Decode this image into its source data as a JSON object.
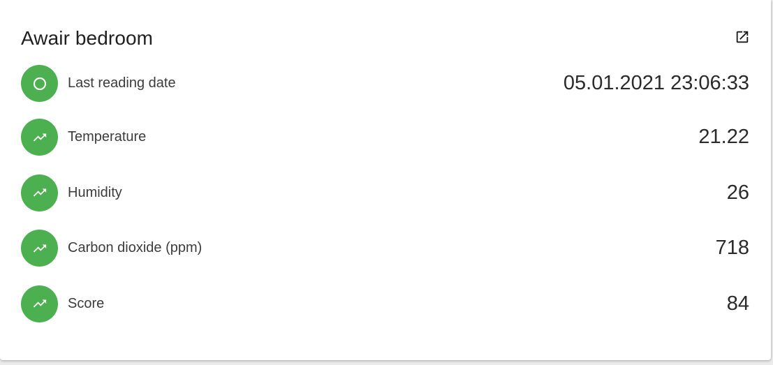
{
  "card": {
    "title": "Awair bedroom",
    "open_icon": "open-in-new-icon"
  },
  "colors": {
    "badge": "#4caf50",
    "card_background": "#ffffff",
    "page_background": "#ececec"
  },
  "rows": [
    {
      "label": "Last reading date",
      "value": "05.01.2021 23:06:33",
      "icon": "circle-outline-icon"
    },
    {
      "label": "Temperature",
      "value": "21.22",
      "icon": "trending-up-icon"
    },
    {
      "label": "Humidity",
      "value": "26",
      "icon": "trending-up-icon"
    },
    {
      "label": "Carbon dioxide (ppm)",
      "value": "718",
      "icon": "trending-up-icon"
    },
    {
      "label": "Score",
      "value": "84",
      "icon": "trending-up-icon"
    }
  ]
}
